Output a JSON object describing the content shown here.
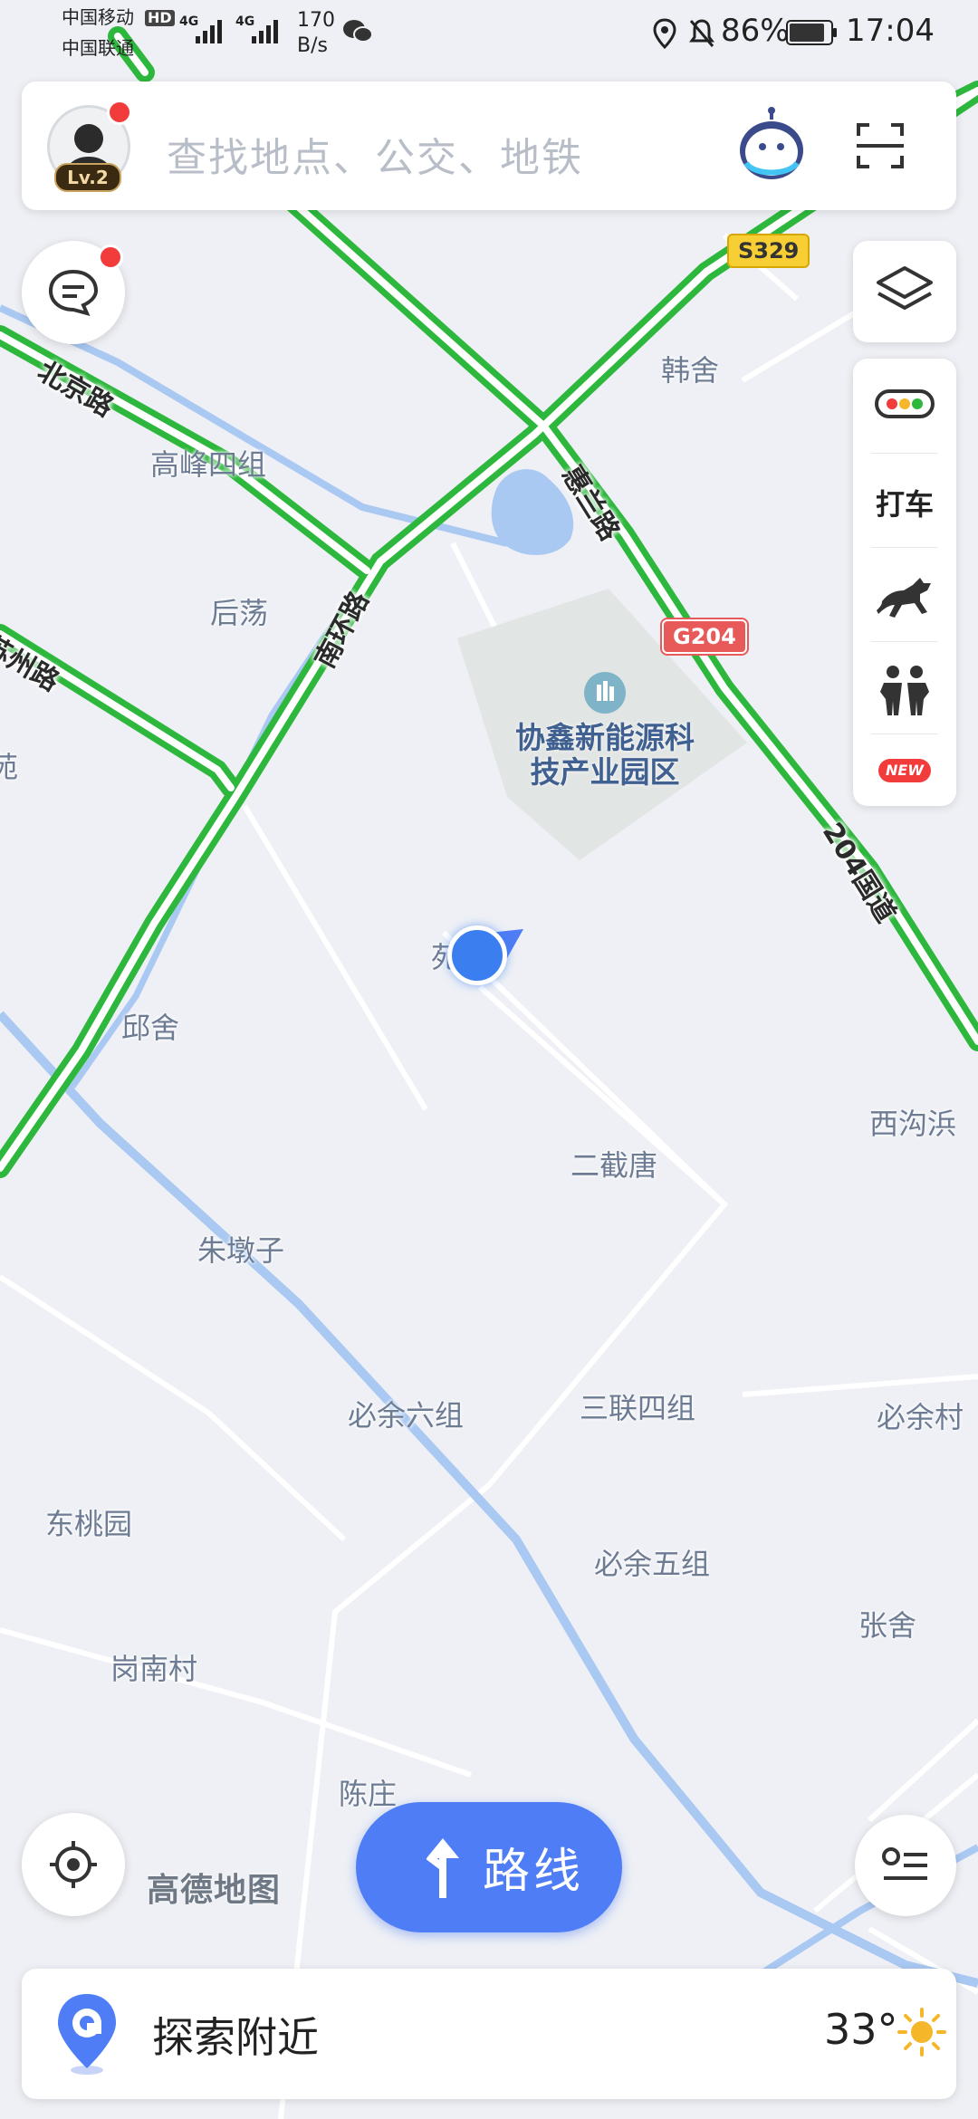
{
  "status_bar": {
    "carrier1": "中国移动",
    "hd": "HD",
    "carrier2": "中国联通",
    "net1": "4G",
    "net2": "4G",
    "speed_value": "170",
    "speed_unit": "B/s",
    "battery": "86%",
    "time": "17:04"
  },
  "search": {
    "placeholder": "查找地点、公交、地铁",
    "level_badge": "Lv.2"
  },
  "map": {
    "places": [
      "韩舍",
      "高峰四组",
      "后荡",
      "苑",
      "邱舍",
      "二截唐",
      "西沟浜",
      "朱墩子",
      "必余六组",
      "三联四组",
      "必余村",
      "东桃园",
      "必余五组",
      "张舍",
      "岗南村",
      "陈庄"
    ],
    "roads": {
      "beijing": "北京路",
      "nanhuan": "南环路",
      "suzhou": "苏州路",
      "road_204": "204国道",
      "huilan": "惠兰路"
    },
    "shields": {
      "s329": "S329",
      "g204": "G204"
    },
    "poi": {
      "line1": "协鑫新能源科",
      "line2": "技产业园区"
    },
    "watermark": "高德地图",
    "user_char": "苑"
  },
  "toolbar": {
    "taxi": "打车",
    "new_badge": "NEW"
  },
  "route_button": {
    "label": "路线"
  },
  "bottom_card": {
    "label": "探索附近",
    "temperature": "33°"
  },
  "colors": {
    "road_green": "#2db83d",
    "water": "#a9c8f2",
    "accent_blue": "#4e7df5",
    "poi_area": "#e1e5e3"
  }
}
